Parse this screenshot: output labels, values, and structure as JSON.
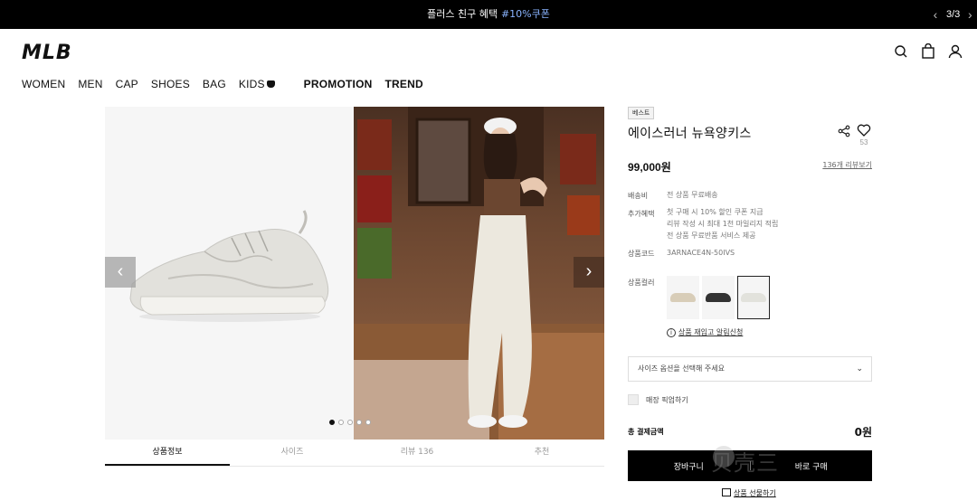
{
  "announcement": {
    "text": "플러스 친구 혜택",
    "highlight": "#10%쿠폰",
    "counter": "3/3"
  },
  "header": {
    "logo": "MLB"
  },
  "nav": {
    "items": [
      "WOMEN",
      "MEN",
      "CAP",
      "SHOES",
      "BAG",
      "KIDS"
    ],
    "promo_items": [
      "PROMOTION",
      "TREND"
    ]
  },
  "gallery": {
    "slides": 5,
    "active_slide": 1
  },
  "tabs": [
    "상품정보",
    "사이즈",
    "리뷰 136",
    "추천"
  ],
  "product": {
    "badge": "베스트",
    "name": "에이스러너 뉴욕양키스",
    "likes": "53",
    "price": "99,000원",
    "reviews_link": "136개 리뷰보기",
    "shipping_label": "배송비",
    "shipping_value": "전 상품 무료배송",
    "benefits_label": "추가혜택",
    "benefits": [
      "첫 구매 시 10% 할인 쿠폰 지급",
      "리뷰 작성 시 최대 1천 마일리지 적립",
      "전 상품 무료반품 서비스 제공"
    ],
    "code_label": "상품코드",
    "code_value": "3ARNACE4N-50IVS",
    "color_label": "상품컬러",
    "colors": [
      "#d8cdb8",
      "#333333",
      "#e2e2dc"
    ],
    "selected_color": 2,
    "restock": "상품 재입고 알림신청",
    "size_placeholder": "사이즈 옵션을 선택해 주세요",
    "pickup": "매장 픽업하기",
    "total_label": "총 결제금액",
    "total_value": "0원",
    "cart_button": "장바구니",
    "buy_button": "바로 구매",
    "gift_link": "상품 선물하기"
  },
  "watermark": "贝壳三",
  "colors": {
    "accent": "#8ab4ff",
    "dark": "#000000"
  }
}
